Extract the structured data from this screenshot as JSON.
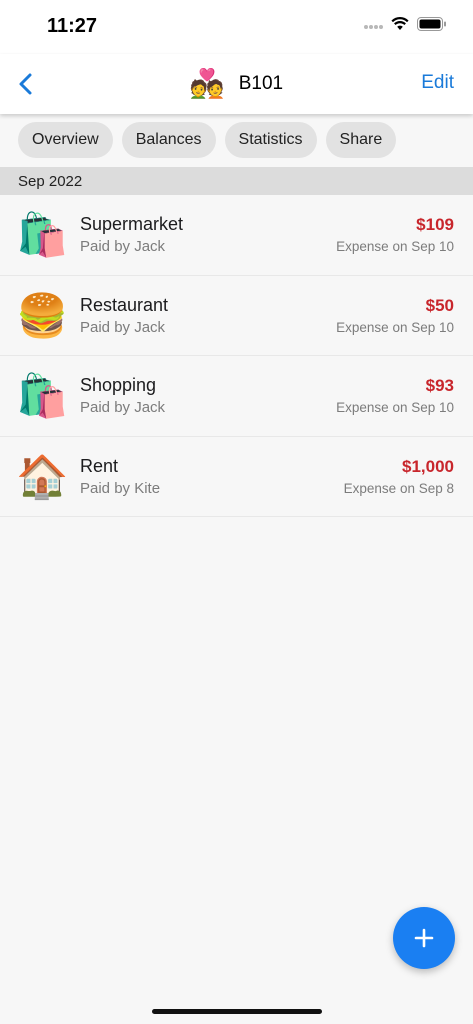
{
  "status_bar": {
    "time": "11:27"
  },
  "nav": {
    "emoji": "💑",
    "title": "B101",
    "edit_label": "Edit"
  },
  "chips": [
    "Overview",
    "Balances",
    "Statistics",
    "Share"
  ],
  "section": {
    "label": "Sep 2022"
  },
  "expenses": [
    {
      "icon": "shopping-bags",
      "emoji": "🛍️",
      "title": "Supermarket",
      "subtitle": "Paid by Jack",
      "amount": "$109",
      "date": "Expense on Sep 10"
    },
    {
      "icon": "hamburger",
      "emoji": "🍔",
      "title": "Restaurant",
      "subtitle": "Paid by Jack",
      "amount": "$50",
      "date": "Expense on Sep 10"
    },
    {
      "icon": "shopping-bags",
      "emoji": "🛍️",
      "title": "Shopping",
      "subtitle": "Paid by Jack",
      "amount": "$93",
      "date": "Expense on Sep 10"
    },
    {
      "icon": "house",
      "emoji": "🏠",
      "title": "Rent",
      "subtitle": "Paid by Kite",
      "amount": "$1,000",
      "date": "Expense on Sep 8"
    }
  ],
  "colors": {
    "accent": "#1a7ad9",
    "fab": "#1a7ff2",
    "amount": "#c8262c"
  }
}
